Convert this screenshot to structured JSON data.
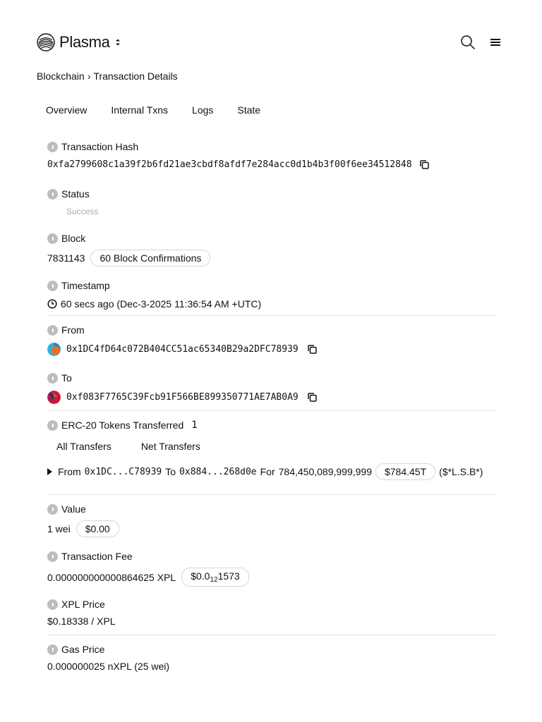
{
  "brand": {
    "name": "Plasma"
  },
  "breadcrumb": {
    "parent": "Blockchain",
    "separator": "›",
    "current": "Transaction Details"
  },
  "tabs": [
    {
      "label": "Overview"
    },
    {
      "label": "Internal Txns"
    },
    {
      "label": "Logs"
    },
    {
      "label": "State"
    }
  ],
  "tx_hash": {
    "label": "Transaction Hash",
    "value": "0xfa2799608c1a39f2b6fd21ae3cbdf8afdf7e284acc0d1b4b3f00f6ee34512848"
  },
  "status": {
    "label": "Status",
    "value": "Success"
  },
  "block": {
    "label": "Block",
    "number": "7831143",
    "confirmations": "60 Block Confirmations"
  },
  "timestamp": {
    "label": "Timestamp",
    "value": "60 secs ago (Dec-3-2025 11:36:54 AM +UTC)"
  },
  "from": {
    "label": "From",
    "address": "0x1DC4fD64c072B404CC51ac65340B29a2DFC78939"
  },
  "to": {
    "label": "To",
    "address": "0xf083F7765C39Fcb91F566BE899350771AE7AB0A9"
  },
  "tokens": {
    "label": "ERC-20 Tokens Transferred",
    "count": "1",
    "sub_tabs": [
      {
        "label": "All Transfers"
      },
      {
        "label": "Net Transfers"
      }
    ],
    "transfer": {
      "from_word": "From",
      "from_address": "0x1DC...C78939",
      "to_word": "To",
      "to_address": "0x884...268d0e",
      "for_word": "For",
      "amount": "784,450,089,999,999",
      "usd": "$784.45T",
      "token": "($*L.S.B*)"
    }
  },
  "value": {
    "label": "Value",
    "amount": "1 wei",
    "usd": "$0.00"
  },
  "fee": {
    "label": "Transaction Fee",
    "amount": "0.000000000000864625 XPL",
    "usd_prefix": "$0.0",
    "usd_sub": "12",
    "usd_suffix": "1573"
  },
  "xpl_price": {
    "label": "XPL Price",
    "value": "$0.18338 / XPL"
  },
  "gas_price": {
    "label": "Gas Price",
    "value": "0.000000025 nXPL (25 wei)"
  },
  "colors": {
    "text": "#111111",
    "muted": "#aaaaaa",
    "divider": "#e4e4e4",
    "info_icon": "#bdbdbd"
  }
}
